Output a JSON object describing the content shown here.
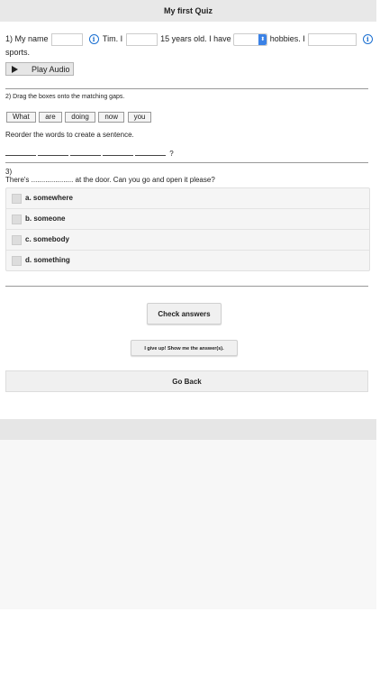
{
  "header": {
    "title": "My first Quiz"
  },
  "q1": {
    "number": "1)",
    "part1": "My name",
    "part2": "Tim. I",
    "part3": "15 years old. I have",
    "part4": "hobbies. I",
    "part5": "sports.",
    "play_label": "Play Audio"
  },
  "q2": {
    "title": "2) Drag the boxes onto the matching gaps.",
    "words": [
      "What",
      "are",
      "doing",
      "now",
      "you"
    ],
    "instruction": "Reorder the words to create a sentence.",
    "end_mark": "?"
  },
  "q3": {
    "number": "3)",
    "prompt": "There's ..................... at the door. Can you go and open it please?",
    "options": [
      "a. somewhere",
      "b. someone",
      "c. somebody",
      "d. something"
    ]
  },
  "buttons": {
    "check": "Check answers",
    "give_up": "I give up! Show me the answer(s).",
    "go_back": "Go Back"
  },
  "colors": {
    "info_blue": "#1a6fd1",
    "select_arrow": "#3b82e6"
  }
}
